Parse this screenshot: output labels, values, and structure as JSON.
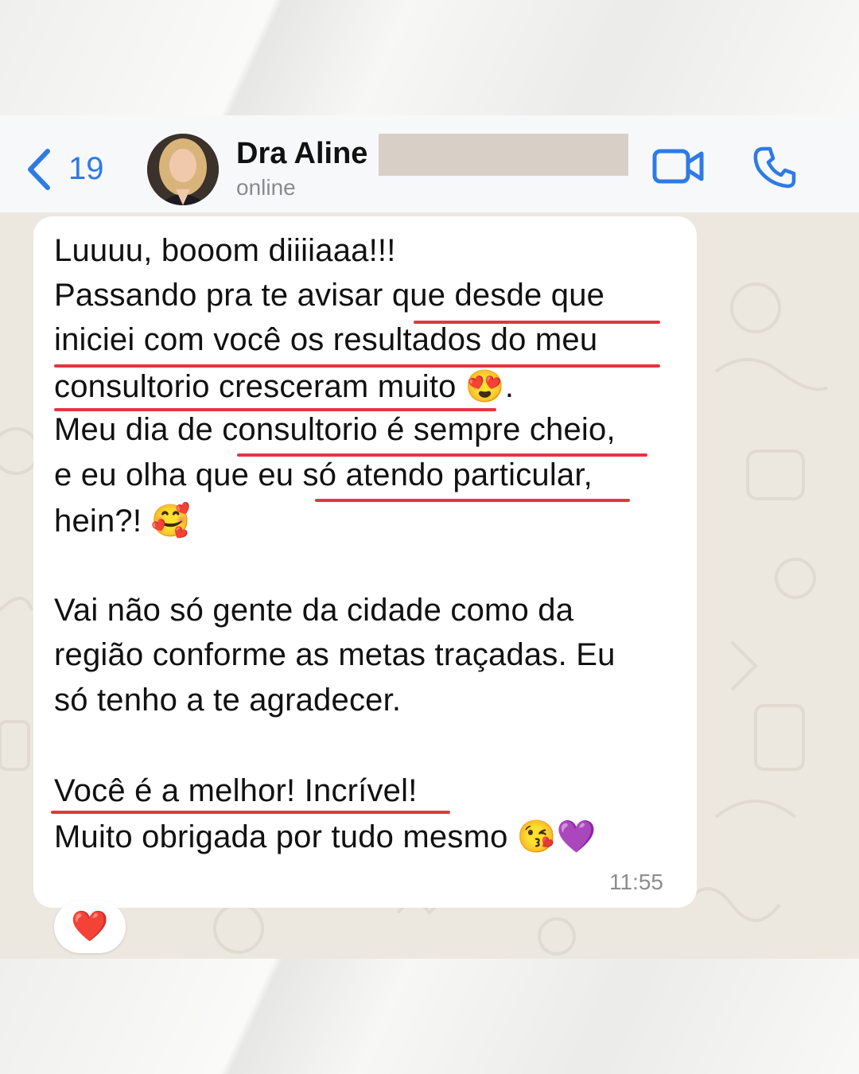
{
  "header": {
    "back_count": "19",
    "contact_name": "Dra Aline",
    "status": "online"
  },
  "message": {
    "lines": [
      "Luuuu, booom diiiiaaa!!!",
      "Passando pra te avisar que desde que",
      "iniciei com você os resultados do meu",
      "consultorio cresceram muito 😍.",
      "Meu dia de consultorio é sempre cheio,",
      "e eu olha que eu só atendo particular,",
      "hein?! 🥰",
      "Vai não só gente da cidade como da",
      "região conforme as metas traçadas. Eu",
      "só tenho a te agradecer.",
      "Você é a melhor! Incrível!",
      "Muito obrigada por tudo mesmo 😘💜"
    ],
    "time": "11:55",
    "reaction": "❤️"
  },
  "colors": {
    "accent": "#2e7ae6",
    "underline": "#e53540",
    "chat_background": "#ece7df",
    "bubble": "#ffffff"
  },
  "icons": {
    "back": "chevron-left-icon",
    "video": "video-camera-icon",
    "call": "phone-icon"
  }
}
